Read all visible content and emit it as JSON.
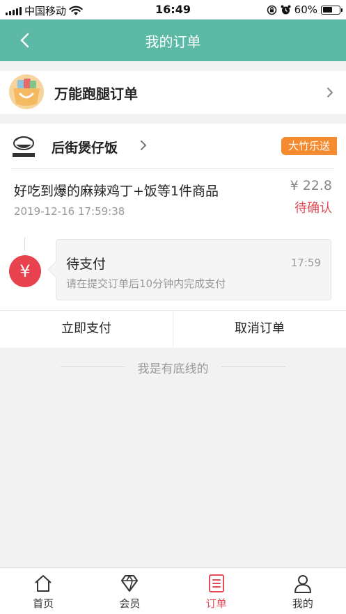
{
  "status_bar": {
    "carrier": "中国移动",
    "time": "16:49",
    "battery": "60%",
    "battery_level": 0.6
  },
  "nav": {
    "title": "我的订单",
    "back_icon": "chevron-left-icon"
  },
  "run_order": {
    "label": "万能跑腿订单"
  },
  "order": {
    "shop_name": "后街煲仔饭",
    "delivery_tag": "大竹乐送",
    "goods": "好吃到爆的麻辣鸡丁+饭等1件商品",
    "price": "¥ 22.8",
    "created_at": "2019-12-16 17:59:38",
    "status": "待确认",
    "timeline": {
      "badge": "¥",
      "title": "待支付",
      "time": "17:59",
      "desc": "请在提交订单后10分钟内完成支付"
    },
    "actions": {
      "pay": "立即支付",
      "cancel": "取消订单"
    }
  },
  "footer_note": "我是有底线的",
  "tabbar": {
    "items": [
      {
        "label": "首页",
        "icon": "home-icon"
      },
      {
        "label": "会员",
        "icon": "diamond-icon"
      },
      {
        "label": "订单",
        "icon": "order-list-icon",
        "active": true
      },
      {
        "label": "我的",
        "icon": "user-icon"
      }
    ]
  },
  "colors": {
    "primary": "#5bb9a6",
    "accent_red": "#e04b57",
    "tag_orange": "#f58a2e"
  }
}
